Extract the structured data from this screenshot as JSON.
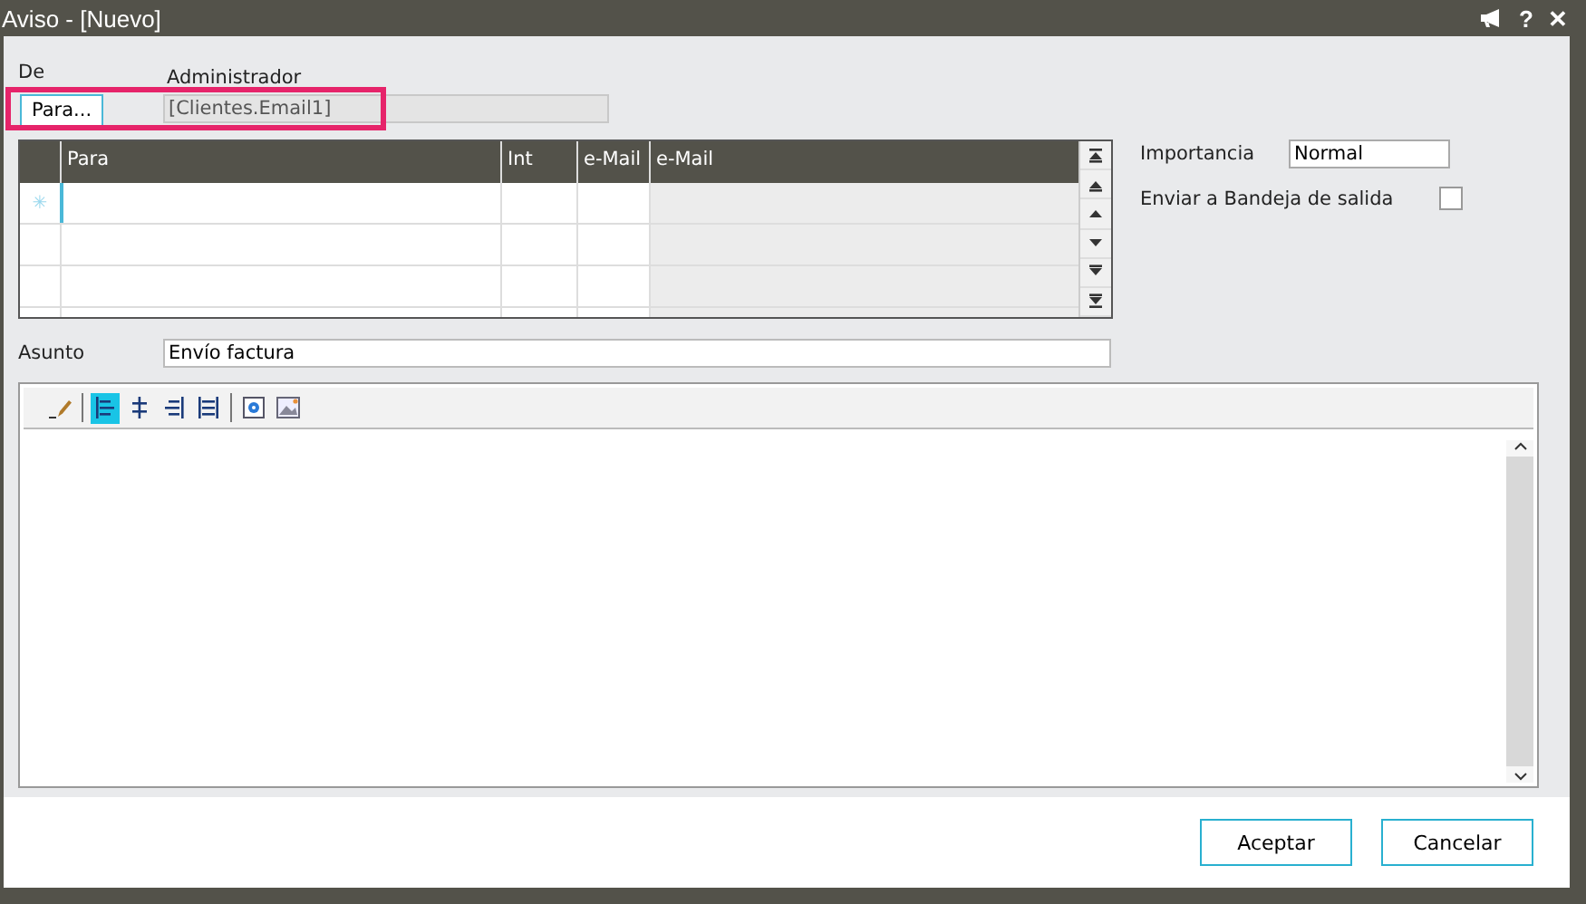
{
  "window": {
    "title": "Aviso - [Nuevo]",
    "help": "?",
    "close": "✕"
  },
  "from": {
    "label": "De",
    "sender": "Administrador"
  },
  "to_button": "Para...",
  "to_field": {
    "value": "[Clientes.Email1]",
    "disabled": true
  },
  "highlight": true,
  "grid": {
    "columns": [
      "Para",
      "Int",
      "e-Mail",
      "e-Mail"
    ],
    "rows": [
      {
        "marker": "✳",
        "current": true
      },
      {
        "current": false
      },
      {
        "current": false
      },
      {
        "current": false
      }
    ]
  },
  "importance": {
    "label": "Importancia",
    "value": "Normal"
  },
  "outbox": {
    "label": "Enviar a Bandeja de salida",
    "checked": false
  },
  "subject": {
    "label": "Asunto",
    "value": "Envío factura"
  },
  "toolbar": [
    {
      "kind": "pencil",
      "selected": false
    },
    {
      "kind": "separator"
    },
    {
      "kind": "align-left",
      "selected": true
    },
    {
      "kind": "align-center",
      "selected": false
    },
    {
      "kind": "align-right",
      "selected": false
    },
    {
      "kind": "justify",
      "selected": false
    },
    {
      "kind": "separator"
    },
    {
      "kind": "image-settings",
      "selected": false
    },
    {
      "kind": "image",
      "selected": false
    }
  ],
  "buttons": [
    "Aceptar",
    "Cancelar"
  ]
}
